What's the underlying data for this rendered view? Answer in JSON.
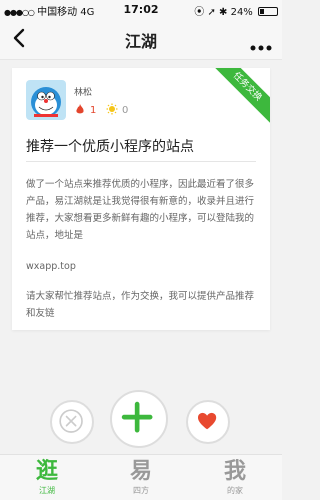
{
  "status_bar": {
    "signal_dots": "●●●○○",
    "carrier": "中国移动",
    "network": "4G",
    "time": "17:02",
    "icons": "⦿ ➚ ✱",
    "battery_text": "24%",
    "battery_level": 0.24
  },
  "nav": {
    "title": "江湖",
    "back_icon": "chevron-left-icon",
    "more_icon": "more-dots-icon"
  },
  "card": {
    "username": "林松",
    "fire_count": "1",
    "sun_count": "0",
    "ribbon": "任务交换",
    "title": "推荐一个优质小程序的站点",
    "paragraphs": [
      "做了一个站点来推荐优质的小程序，因此最近看了很多产品，易江湖就是让我觉得很有新意的，收录并且进行推荐，大家想看更多新鲜有趣的小程序，可以登陆我的站点，地址是",
      "wxapp.top",
      "请大家帮忙推荐站点，作为交换，我可以提供产品推荐和友链"
    ]
  },
  "actions": {
    "dislike_icon": "close-icon",
    "add_icon": "plus-icon",
    "like_icon": "heart-icon"
  },
  "tabs": [
    {
      "glyph": "逛",
      "label": "江湖",
      "active": true
    },
    {
      "glyph": "易",
      "label": "四方",
      "active": false
    },
    {
      "glyph": "我",
      "label": "的家",
      "active": false
    }
  ],
  "colors": {
    "accent_green": "#3db83d",
    "heart_red": "#e8492f",
    "fire_red": "#e3452c",
    "sun_yellow": "#f5c518"
  }
}
